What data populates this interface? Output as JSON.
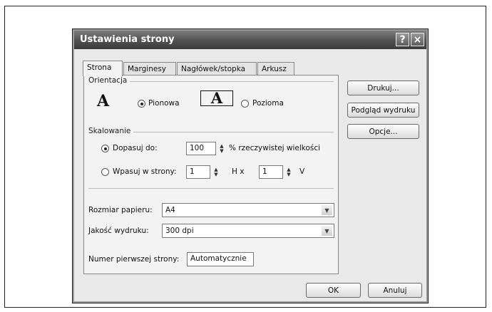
{
  "dialog": {
    "title": "Ustawienia strony",
    "help_glyph": "?",
    "close_glyph": "×"
  },
  "tabs": [
    {
      "label": "Strona",
      "active": true
    },
    {
      "label": "Marginesy"
    },
    {
      "label": "Nagłówek/stopka"
    },
    {
      "label": "Arkusz"
    }
  ],
  "orientation": {
    "group_label": "Orientacja",
    "portrait_label": "Pionowa",
    "landscape_label": "Pozioma",
    "icon_letter": "A",
    "selected": "Pionowa"
  },
  "scaling": {
    "group_label": "Skalowanie",
    "adjust_label": "Dopasuj do:",
    "adjust_value": "100",
    "adjust_suffix": "% rzeczywistej wielkości",
    "fit_label": "Wpasuj w strony:",
    "fit_wide_value": "1",
    "fit_mid": "H x",
    "fit_tall_value": "1",
    "fit_suffix": "V",
    "selected": "Dopasuj do:"
  },
  "paper": {
    "size_label": "Rozmiar papieru:",
    "size_value": "A4",
    "quality_label": "Jakość wydruku:",
    "quality_value": "300 dpi",
    "first_page_label": "Numer pierwszej strony:",
    "first_page_value": "Automatycznie"
  },
  "side_buttons": {
    "print": "Drukuj...",
    "preview": "Podgląd wydruku",
    "options": "Opcje..."
  },
  "footer": {
    "ok": "OK",
    "cancel": "Anuluj"
  }
}
